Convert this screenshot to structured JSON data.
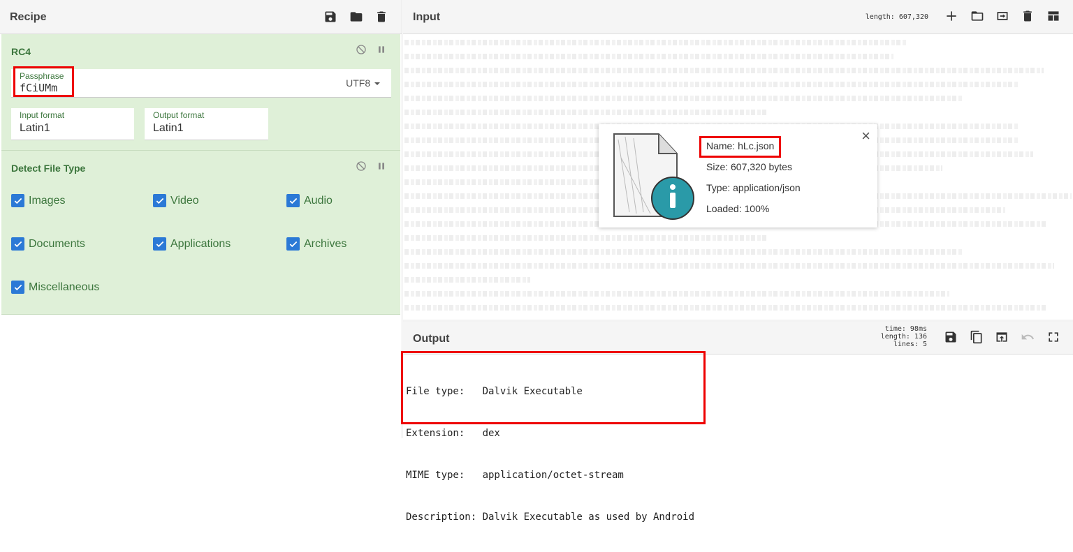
{
  "recipe": {
    "title": "Recipe",
    "actions": [
      "save-icon",
      "folder-icon",
      "trash-icon"
    ]
  },
  "rc4": {
    "title": "RC4",
    "passphrase_label": "Passphrase",
    "passphrase_value": "fCiUMm",
    "encoding": "UTF8",
    "input_format_label": "Input format",
    "input_format_value": "Latin1",
    "output_format_label": "Output format",
    "output_format_value": "Latin1"
  },
  "detect": {
    "title": "Detect File Type",
    "options": [
      {
        "label": "Images",
        "checked": true
      },
      {
        "label": "Video",
        "checked": true
      },
      {
        "label": "Audio",
        "checked": true
      },
      {
        "label": "Documents",
        "checked": true
      },
      {
        "label": "Applications",
        "checked": true
      },
      {
        "label": "Archives",
        "checked": true
      },
      {
        "label": "Miscellaneous",
        "checked": true
      }
    ]
  },
  "input": {
    "title": "Input",
    "length_text": "length: 607,320",
    "file": {
      "name": "Name: hLc.json",
      "size": "Size: 607,320 bytes",
      "type": "Type: application/json",
      "loaded": "Loaded: 100%",
      "close": "×"
    }
  },
  "output": {
    "title": "Output",
    "stats": {
      "time": "time: 98ms",
      "length": "length:   136",
      "lines": "lines:     5"
    },
    "lines": [
      "File type:   Dalvik Executable",
      "Extension:   dex",
      "MIME type:   application/octet-stream",
      "Description: Dalvik Executable as used by Android"
    ]
  }
}
